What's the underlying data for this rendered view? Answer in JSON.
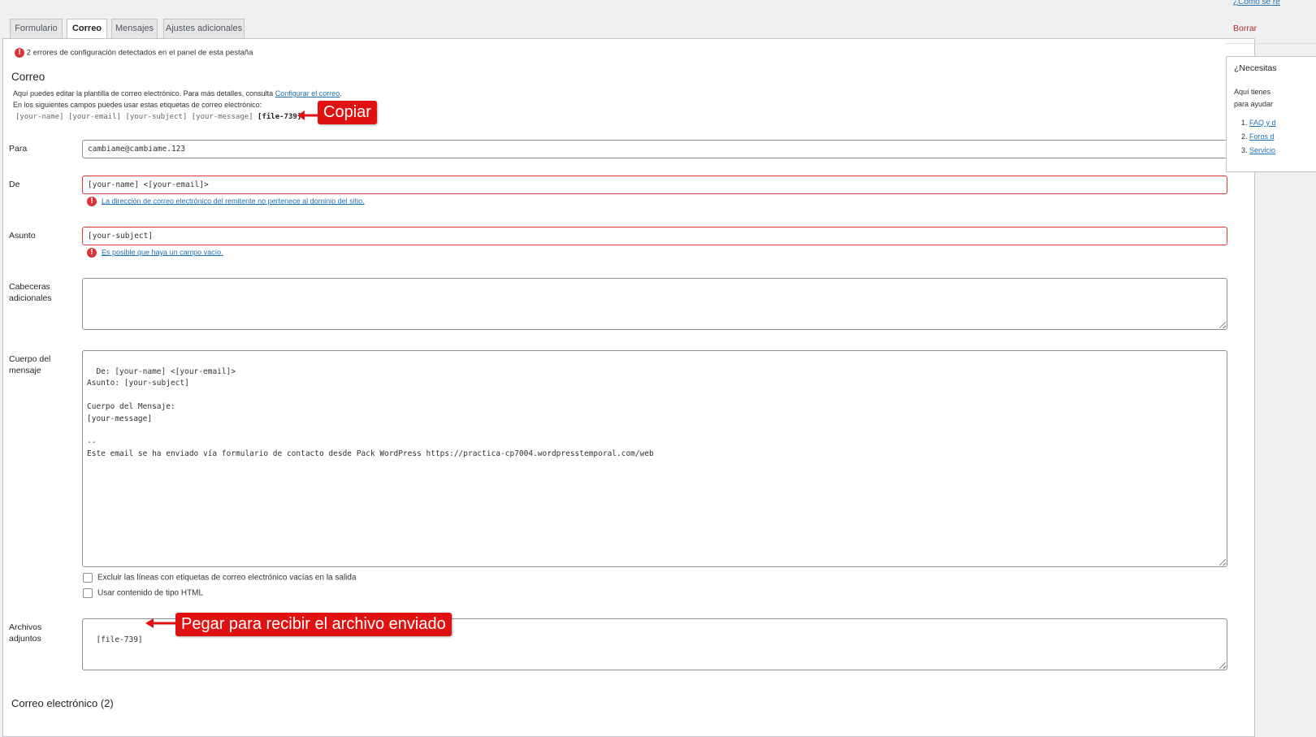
{
  "tabs": [
    {
      "label": "Formulario"
    },
    {
      "label": "Correo"
    },
    {
      "label": "Mensajes"
    },
    {
      "label": "Ajustes adicionales"
    }
  ],
  "notice": "2 errores de configuración detectados en el panel de esta pestaña",
  "section_title": "Correo",
  "intro": {
    "line1_prefix": "Aquí puedes editar la plantilla de correo electrónico. Para más detalles, consulta ",
    "line1_link": "Configurar el correo",
    "line1_suffix": ".",
    "line2": "En los siguientes campos puedes usar estas etiquetas de correo electrónico:",
    "tags": "[your-name] [your-email] [your-subject] [your-message]",
    "tag_bold": "[file-739]"
  },
  "fields": {
    "para": {
      "label": "Para",
      "value": "cambiame@cambiame.123"
    },
    "de": {
      "label": "De",
      "value": "[your-name] <[your-email]>",
      "error": "La dirección de correo electrónico del remitente no pertenece al dominio del sitio."
    },
    "asunto": {
      "label": "Asunto",
      "value": "[your-subject]",
      "error": "Es posible que haya un campo vacío."
    },
    "cabeceras": {
      "label": "Cabeceras adicionales",
      "value": ""
    },
    "cuerpo": {
      "label": "Cuerpo del mensaje",
      "value": "De: [your-name] <[your-email]>\nAsunto: [your-subject]\n\nCuerpo del Mensaje:\n[your-message]\n\n--\nEste email se ha enviado vía formulario de contacto desde Pack WordPress https://practica-cp7004.wordpresstemporal.com/web"
    },
    "archivos": {
      "label": "Archivos adjuntos",
      "value": "[file-739]"
    }
  },
  "checkboxes": {
    "exclude_blank": {
      "label": "Excluir las líneas con etiquetas de correo electrónico vacías en la salida",
      "checked": false
    },
    "use_html": {
      "label": "Usar contenido de tipo HTML",
      "checked": false
    }
  },
  "bottom_partial": "Correo electrónico (2)",
  "callouts": {
    "copy": "Copiar",
    "paste": "Pegar para recibir el archivo enviado"
  },
  "sidebar": {
    "help_link": "¿Cómo se re",
    "delete": "Borrar",
    "help_title": "¿Necesitas",
    "help_text1": "Aquí tienes",
    "help_text2": "para ayudar",
    "links": [
      "FAQ y d",
      "Foros d",
      "Servicio"
    ]
  },
  "colors": {
    "error": "#d63638",
    "link": "#2271b1",
    "callout": "#e01111"
  }
}
